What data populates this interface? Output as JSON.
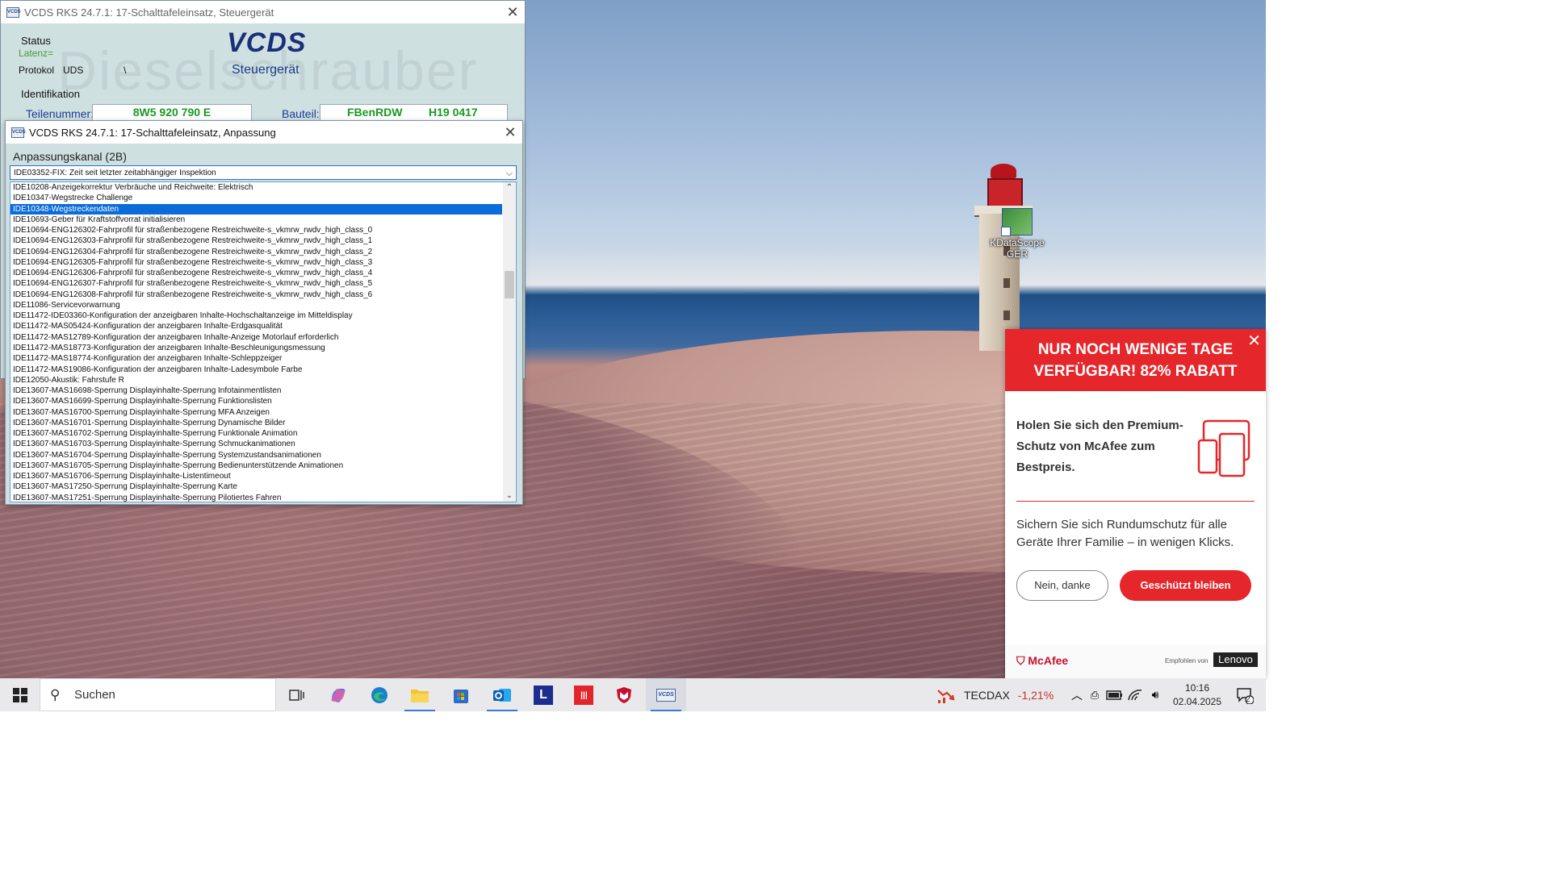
{
  "vcds_main": {
    "title": "VCDS RKS 24.7.1: 17-Schalttafeleinsatz,  Steuergerät",
    "logo": "VCDS",
    "logo_sub": "Steuergerät",
    "watermark": "Dieselschrauber",
    "status_label": "Status",
    "latency_label": "Latenz=",
    "protocol_label": "Protokol",
    "protocol_value": "UDS",
    "protocol_extra": "\\",
    "ident_label": "Identifikation",
    "part_label": "Teilenummer:",
    "part_value": "8W5 920 790 E",
    "component_label": "Bauteil:",
    "component_value1": "FBenRDW",
    "component_value2": "H19 0417"
  },
  "vcds_adapt": {
    "title": "VCDS RKS 24.7.1: 17-Schalttafeleinsatz,  Anpassung",
    "channel_label": "Anpassungskanal (2B)",
    "combo_value": "IDE03352-FIX: Zeit seit letzter zeitabhängiger Inspektion",
    "selected_index": 2,
    "items": [
      "IDE10208-Anzeigekorrektur Verbräuche und Reichweite: Elektrisch",
      "IDE10347-Wegstrecke Challenge",
      "IDE10348-Wegstreckendaten",
      "IDE10693-Geber für Kraftstoffvorrat initialisieren",
      "IDE10694-ENG126302-Fahrprofil für straßenbezogene Restreichweite-s_vkmrw_rwdv_high_class_0",
      "IDE10694-ENG126303-Fahrprofil für straßenbezogene Restreichweite-s_vkmrw_rwdv_high_class_1",
      "IDE10694-ENG126304-Fahrprofil für straßenbezogene Restreichweite-s_vkmrw_rwdv_high_class_2",
      "IDE10694-ENG126305-Fahrprofil für straßenbezogene Restreichweite-s_vkmrw_rwdv_high_class_3",
      "IDE10694-ENG126306-Fahrprofil für straßenbezogene Restreichweite-s_vkmrw_rwdv_high_class_4",
      "IDE10694-ENG126307-Fahrprofil für straßenbezogene Restreichweite-s_vkmrw_rwdv_high_class_5",
      "IDE10694-ENG126308-Fahrprofil für straßenbezogene Restreichweite-s_vkmrw_rwdv_high_class_6",
      "IDE11086-Servicevorwarnung",
      "IDE11472-IDE03360-Konfiguration der anzeigbaren Inhalte-Hochschaltanzeige im Mitteldisplay",
      "IDE11472-MAS05424-Konfiguration der anzeigbaren Inhalte-Erdgasqualität",
      "IDE11472-MAS12789-Konfiguration der anzeigbaren Inhalte-Anzeige Motorlauf erforderlich",
      "IDE11472-MAS18773-Konfiguration der anzeigbaren Inhalte-Beschleunigungsmessung",
      "IDE11472-MAS18774-Konfiguration der anzeigbaren Inhalte-Schleppzeiger",
      "IDE11472-MAS19086-Konfiguration der anzeigbaren Inhalte-Ladesymbole Farbe",
      "IDE12050-Akustik: Fahrstufe R",
      "IDE13607-MAS16698-Sperrung Displayinhalte-Sperrung Infotainmentlisten",
      "IDE13607-MAS16699-Sperrung Displayinhalte-Sperrung Funktionslisten",
      "IDE13607-MAS16700-Sperrung Displayinhalte-Sperrung MFA Anzeigen",
      "IDE13607-MAS16701-Sperrung Displayinhalte-Sperrung Dynamische Bilder",
      "IDE13607-MAS16702-Sperrung Displayinhalte-Sperrung Funktionale Animation",
      "IDE13607-MAS16703-Sperrung Displayinhalte-Sperrung Schmuckanimationen",
      "IDE13607-MAS16704-Sperrung Displayinhalte-Sperrung Systemzustandsanimationen",
      "IDE13607-MAS16705-Sperrung Displayinhalte-Sperrung Bedienunterstützende Animationen",
      "IDE13607-MAS16706-Sperrung Displayinhalte-Listentimeout",
      "IDE13607-MAS17250-Sperrung Displayinhalte-Sperrung Karte",
      "IDE13607-MAS17251-Sperrung Displayinhalte-Sperrung Pilotiertes Fahren"
    ]
  },
  "desktop": {
    "icon_label": "KDataScope GER"
  },
  "ad": {
    "headline": "NUR NOCH WENIGE TAGE VERFÜGBAR! 82% RABATT",
    "title": "Holen Sie sich den Premium-Schutz von McAfee zum Bestpreis.",
    "text": "Sichern Sie sich Rundumschutz für alle Geräte Ihrer Familie – in wenigen Klicks.",
    "btn_no": "Nein, danke",
    "btn_yes": "Geschützt bleiben",
    "brand": "McAfee",
    "recommended_by": "Empfohlen von",
    "partner": "Lenovo",
    "accent": "#e5262b"
  },
  "taskbar": {
    "search_placeholder": "Suchen",
    "apps": [
      "task-view",
      "copilot",
      "edge",
      "file-explorer",
      "store",
      "outlook",
      "lexware",
      "app-red",
      "mcafee",
      "vcds"
    ],
    "ticker_name": "TECDAX",
    "ticker_change": "-1,21%",
    "time": "10:16",
    "date": "02.04.2025",
    "notification_count": "2"
  }
}
